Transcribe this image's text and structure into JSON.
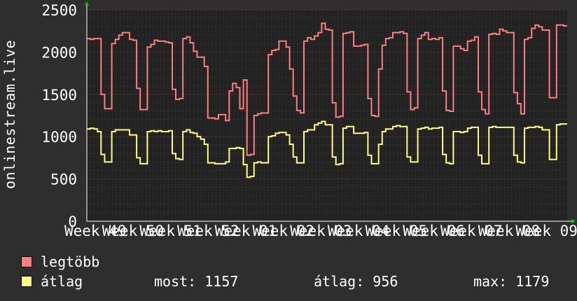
{
  "chart_data": {
    "type": "line",
    "ylabel": "onlinestream.live",
    "ylim": [
      0,
      2500
    ],
    "yticks": [
      0,
      500,
      1000,
      1500,
      2000,
      2500
    ],
    "xticks": [
      "Week 49",
      "Week 50",
      "Week 51",
      "Week 52",
      "Week 01",
      "Week 02",
      "Week 03",
      "Week 04",
      "Week 05",
      "Week 06",
      "Week 07",
      "Week 08",
      "Week 09"
    ],
    "grid": true,
    "series": [
      {
        "name": "legtöbb",
        "color": "#ff7f7f",
        "values": [
          2160,
          2150,
          2160,
          2160,
          1500,
          1330,
          1330,
          2100,
          2150,
          2200,
          2230,
          2230,
          2150,
          2140,
          1570,
          1320,
          1320,
          2060,
          2090,
          2140,
          2130,
          2130,
          2120,
          2110,
          1560,
          1440,
          1450,
          2160,
          2180,
          2110,
          2010,
          1940,
          1940,
          1830,
          1220,
          1220,
          1210,
          1260,
          1260,
          1190,
          1540,
          1630,
          1580,
          1330,
          1670,
          780,
          790,
          1250,
          1270,
          1280,
          1280,
          1970,
          2020,
          2030,
          2130,
          2130,
          2060,
          1800,
          1480,
          1310,
          1280,
          2130,
          2170,
          2150,
          2190,
          2230,
          2340,
          2270,
          2260,
          1400,
          1230,
          1240,
          2220,
          2230,
          2240,
          2070,
          2070,
          2080,
          2090,
          1450,
          1250,
          1240,
          1800,
          2080,
          2160,
          2170,
          2230,
          2230,
          2240,
          2220,
          1530,
          1320,
          1340,
          2160,
          2200,
          2230,
          2150,
          2160,
          2150,
          2170,
          1540,
          1310,
          1300,
          2070,
          2070,
          2040,
          2020,
          2130,
          2140,
          2180,
          1530,
          1320,
          1270,
          2210,
          2220,
          2210,
          2270,
          2250,
          2230,
          2230,
          1520,
          1390,
          1270,
          2150,
          2170,
          2280,
          2320,
          2300,
          2260,
          2260,
          1460,
          1460,
          2320,
          2320,
          2310
        ]
      },
      {
        "name": "átlag",
        "color": "#ffff80",
        "values": [
          1090,
          1100,
          1090,
          1060,
          790,
          700,
          700,
          1060,
          1080,
          1080,
          1080,
          1080,
          1020,
          1020,
          750,
          680,
          680,
          1060,
          1070,
          1060,
          1070,
          1060,
          1060,
          1070,
          800,
          740,
          730,
          1060,
          1080,
          1050,
          1040,
          1000,
          970,
          910,
          690,
          690,
          680,
          680,
          680,
          700,
          860,
          860,
          870,
          860,
          670,
          520,
          530,
          690,
          700,
          690,
          690,
          1000,
          1010,
          1040,
          1050,
          1050,
          1020,
          910,
          760,
          690,
          690,
          1060,
          1080,
          1080,
          1140,
          1160,
          1180,
          1140,
          1140,
          760,
          670,
          680,
          1100,
          1120,
          1120,
          1040,
          1040,
          1040,
          1050,
          780,
          680,
          680,
          910,
          1060,
          1090,
          1090,
          1120,
          1130,
          1120,
          1120,
          760,
          700,
          700,
          1090,
          1100,
          1110,
          1090,
          1100,
          1100,
          1110,
          790,
          690,
          680,
          1060,
          1060,
          1050,
          1060,
          1100,
          1110,
          1110,
          780,
          680,
          680,
          1110,
          1120,
          1110,
          1110,
          1110,
          1110,
          1110,
          780,
          700,
          690,
          1100,
          1110,
          1110,
          1120,
          1110,
          1080,
          1080,
          730,
          730,
          1140,
          1150,
          1150
        ]
      }
    ]
  },
  "legend": {
    "max_label": "legtöbb",
    "avg_label": "átlag"
  },
  "stats": {
    "now": "most: 1157",
    "avg": "átlag: 956",
    "max": "max: 1179"
  },
  "colors": {
    "background": "#2e2e2e",
    "plot_bg": "#222222",
    "grid": "#4a4a4a",
    "major_grid": "#7a3a3a",
    "axis_arrow": "#00cc00"
  }
}
